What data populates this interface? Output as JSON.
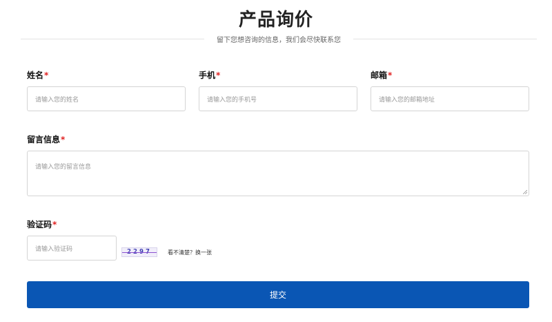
{
  "header": {
    "title": "产品询价",
    "subtitle": "留下您想咨询的信息，我们会尽快联系您"
  },
  "form": {
    "required_mark": "*",
    "name": {
      "label": "姓名",
      "placeholder": "请输入您的姓名"
    },
    "phone": {
      "label": "手机",
      "placeholder": "请输入您的手机号"
    },
    "email": {
      "label": "邮箱",
      "placeholder": "请输入您的邮箱地址"
    },
    "message": {
      "label": "留言信息",
      "placeholder": "请输入您的留言信息"
    },
    "captcha": {
      "label": "验证码",
      "placeholder": "请输入验证码",
      "image_text": "2297",
      "refresh_text": "看不清楚？换一张"
    },
    "submit_label": "提交"
  },
  "colors": {
    "accent": "#0a56b4",
    "required": "#e02020",
    "border": "#d4d4d4"
  }
}
